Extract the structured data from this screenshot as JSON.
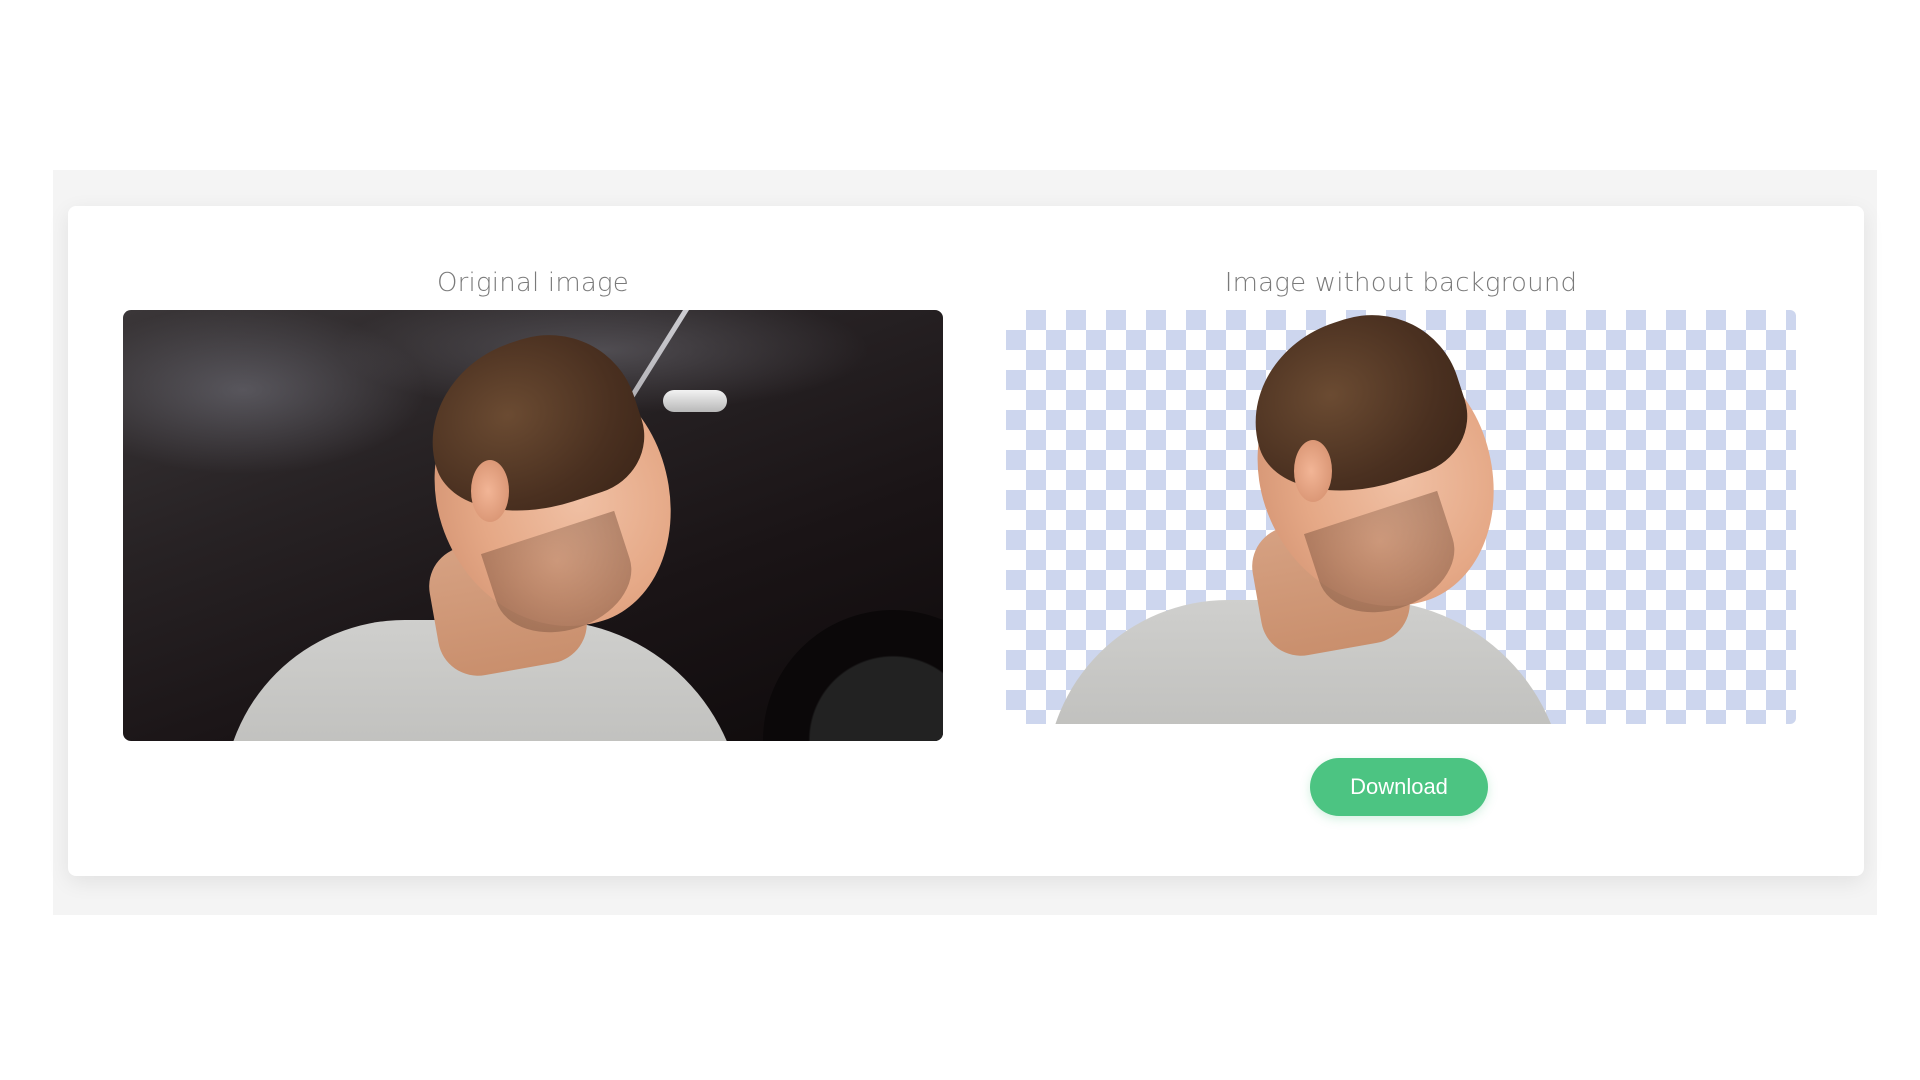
{
  "left_panel": {
    "title": "Original image"
  },
  "right_panel": {
    "title": "Image without background"
  },
  "actions": {
    "download_label": "Download"
  },
  "colors": {
    "accent_green": "#4cc482",
    "checker_blue": "#cdd6ee",
    "outer_bg": "#f4f4f4",
    "card_bg": "#ffffff",
    "label_gray": "#7a7a7a"
  }
}
